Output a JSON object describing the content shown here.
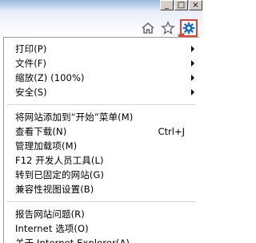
{
  "window": {
    "minimize_glyph": "_",
    "restore_glyph": "□",
    "close_glyph": "×"
  },
  "toolbar": {
    "icons": [
      "home-icon",
      "star-icon",
      "gear-icon"
    ],
    "accent_color": "#e34234",
    "gear_color": "#1e6fc0"
  },
  "menu": {
    "group1": [
      {
        "label": "打印(P)",
        "submenu": true
      },
      {
        "label": "文件(F)",
        "submenu": true
      },
      {
        "label": "缩放(Z) (100%)",
        "submenu": true
      },
      {
        "label": "安全(S)",
        "submenu": true
      }
    ],
    "group2": [
      {
        "label": "将网站添加到“开始”菜单(M)",
        "shortcut": ""
      },
      {
        "label": "查看下载(N)",
        "shortcut": "Ctrl+J"
      },
      {
        "label": "管理加载项(M)",
        "shortcut": ""
      },
      {
        "label": "F12 开发人员工具(L)",
        "shortcut": ""
      },
      {
        "label": "转到已固定的网站(G)",
        "shortcut": ""
      },
      {
        "label": "兼容性视图设置(B)",
        "shortcut": ""
      }
    ],
    "group3": [
      {
        "label": "报告网站问题(R)"
      },
      {
        "label": "Internet 选项(O)"
      },
      {
        "label": "关于 Internet Explorer(A)"
      }
    ]
  }
}
